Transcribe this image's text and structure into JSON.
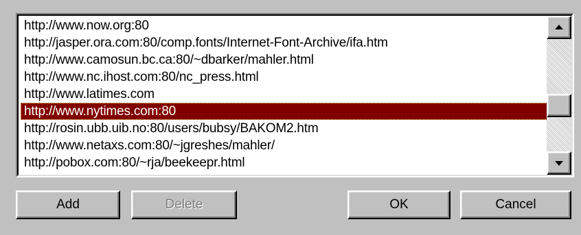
{
  "url_list": {
    "items": [
      "http://www.now.org:80",
      "http://jasper.ora.com:80/comp.fonts/Internet-Font-Archive/ifa.htm",
      "http://www.camosun.bc.ca:80/~dbarker/mahler.html",
      "http://www.nc.ihost.com:80/nc_press.html",
      "http://www.latimes.com",
      "http://www.nytimes.com:80",
      "http://rosin.ubb.uib.no:80/users/bubsy/BAKOM2.htm",
      "http://www.netaxs.com:80/~jgreshes/mahler/",
      "http://pobox.com:80/~rja/beekeepr.html"
    ],
    "selected_index": 5
  },
  "buttons": {
    "add": "Add",
    "delete": "Delete",
    "ok": "OK",
    "cancel": "Cancel"
  },
  "colors": {
    "dialog_background": "#c0c0c0",
    "selection_background": "#800000",
    "selection_text": "#ffffff",
    "disabled_text": "#808080"
  },
  "icons": {
    "scroll_up": "triangle-up-icon",
    "scroll_down": "triangle-down-icon"
  }
}
